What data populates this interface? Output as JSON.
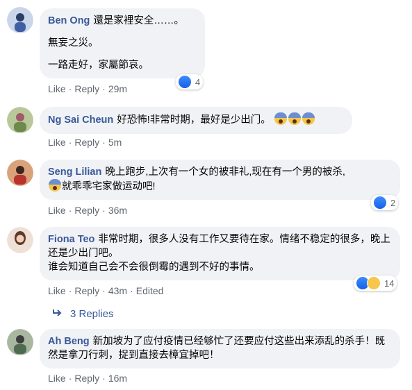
{
  "colors": {
    "author": "#385898",
    "bubble": "#f0f2f5",
    "meta": "#606770",
    "like": "#1877f2"
  },
  "comments": [
    {
      "author": "Ben Ong",
      "lines": [
        "還是家裡安全……。",
        "無妄之災。",
        "一路走好，家屬節哀。"
      ],
      "actions": {
        "like": "Like",
        "reply": "Reply",
        "time": "29m"
      },
      "reaction_count": "4"
    },
    {
      "author": "Ng Sai Cheun",
      "text": "好恐怖!非常时期，最好是少出门。",
      "actions": {
        "like": "Like",
        "reply": "Reply",
        "time": "5m"
      }
    },
    {
      "author": "Seng Lilian",
      "text": "晚上跑步,上次有一个女的被非礼,现在有一个男的被杀,",
      "text2": "就乖乖宅家做运动吧!",
      "actions": {
        "like": "Like",
        "reply": "Reply",
        "time": "36m"
      },
      "reaction_count": "2"
    },
    {
      "author": "Fiona Teo",
      "text": "非常时期，很多人没有工作又要待在家。情绪不稳定的很多，晚上还是少出门吧。",
      "text2": "谁会知道自己会不会很倒霉的遇到不好的事情。",
      "actions": {
        "like": "Like",
        "reply": "Reply",
        "time": "43m",
        "edited": "Edited"
      },
      "reaction_count": "14",
      "replies": "3 Replies"
    },
    {
      "author": "Ah Beng",
      "text": "新加坡为了应付疫情已经够忙了还要应付这些出来添乱的杀手！既然是拿刀行刺，捉到直接去樟宜掉吧！",
      "actions": {
        "like": "Like",
        "reply": "Reply",
        "time": "16m"
      }
    }
  ]
}
